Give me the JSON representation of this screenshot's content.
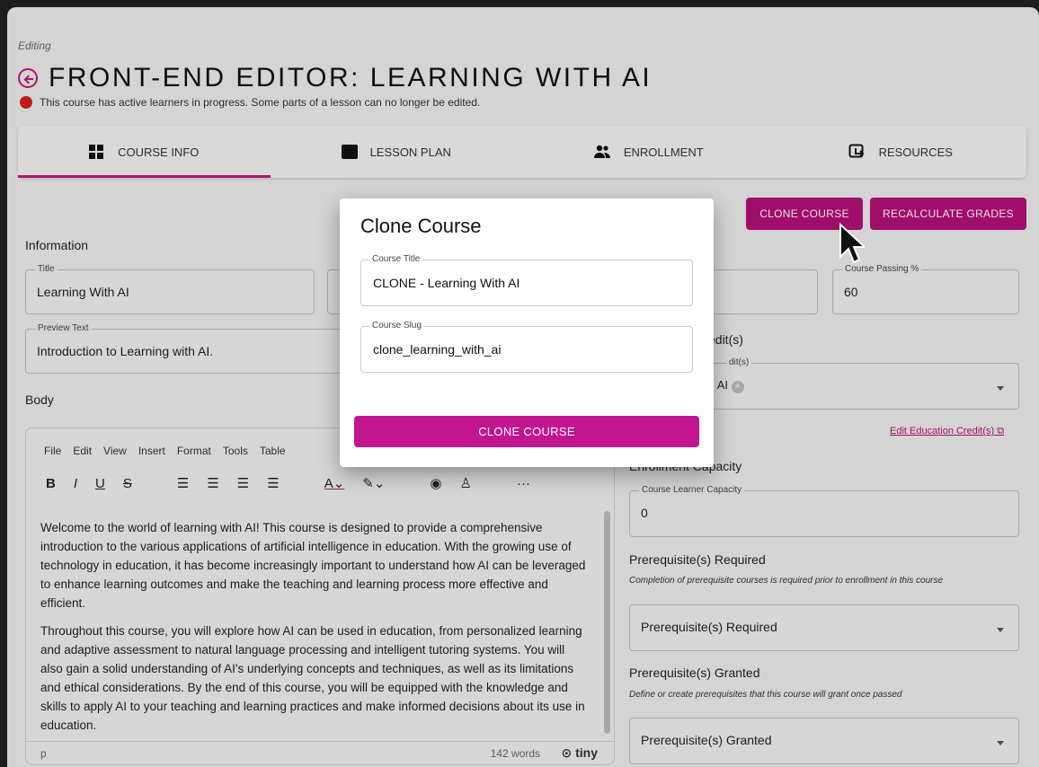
{
  "header": {
    "editing_label": "Editing",
    "title": "FRONT-END EDITOR: LEARNING WITH AI",
    "warning": "This course has active learners in progress. Some parts of a lesson can no longer be edited.",
    "accent_color": "#c2167f",
    "warning_color": "#d32020"
  },
  "tabs": [
    {
      "label": "COURSE INFO",
      "icon": "dashboard-icon",
      "active": true
    },
    {
      "label": "LESSON PLAN",
      "icon": "book-icon",
      "active": false
    },
    {
      "label": "ENROLLMENT",
      "icon": "people-icon",
      "active": false
    },
    {
      "label": "RESOURCES",
      "icon": "resources-icon",
      "active": false
    }
  ],
  "actions": {
    "clone_course": "CLONE COURSE",
    "recalculate_grades": "RECALCULATE GRADES"
  },
  "information": {
    "section_label": "Information",
    "title_label": "Title",
    "title_value": "Learning With AI",
    "passing_label": "Course Passing %",
    "passing_value": "60",
    "preview_label": "Preview Text",
    "preview_value": "Introduction to Learning with AI.",
    "body_label": "Body"
  },
  "editor": {
    "menu": [
      "File",
      "Edit",
      "View",
      "Insert",
      "Format",
      "Tools",
      "Table"
    ],
    "paragraphs": [
      "Welcome to the world of learning with AI! This course is designed to provide a comprehensive introduction to the various applications of artificial intelligence in education. With the growing use of technology in education, it has become increasingly important to understand how AI can be leveraged to enhance learning outcomes and make the teaching and learning process more effective and efficient.",
      "Throughout this course, you will explore how AI can be used in education, from personalized learning and adaptive assessment to natural language processing and intelligent tutoring systems. You will also gain a solid understanding of AI's underlying concepts and techniques, as well as its limitations and ethical considerations. By the end of this course, you will be equipped with the knowledge and skills to apply AI to your teaching and learning practices and make informed decisions about its use in education."
    ],
    "status_path": "p",
    "word_count": "142 words",
    "brand": "tiny"
  },
  "credits": {
    "section_partial": "edit(s)",
    "field_label_partial": "dit(s)",
    "chip_partial": "th AI",
    "edit_link": "Edit Education Credit(s)"
  },
  "enrollment": {
    "section_partial": "Enrollment Capacity",
    "capacity_label": "Course Learner Capacity",
    "capacity_value": "0"
  },
  "prereq_required": {
    "section_label": "Prerequisite(s) Required",
    "help": "Completion of prerequisite courses is required prior to enrollment in this course",
    "placeholder": "Prerequisite(s) Required"
  },
  "prereq_granted": {
    "section_label": "Prerequisite(s) Granted",
    "help": "Define or create prerequisites that this course will grant once passed",
    "placeholder": "Prerequisite(s) Granted"
  },
  "modal": {
    "title": "Clone Course",
    "course_title_label": "Course Title",
    "course_title_value": "CLONE - Learning With AI",
    "course_slug_label": "Course Slug",
    "course_slug_value": "clone_learning_with_ai",
    "submit_label": "CLONE COURSE",
    "button_color": "#c2168f"
  }
}
